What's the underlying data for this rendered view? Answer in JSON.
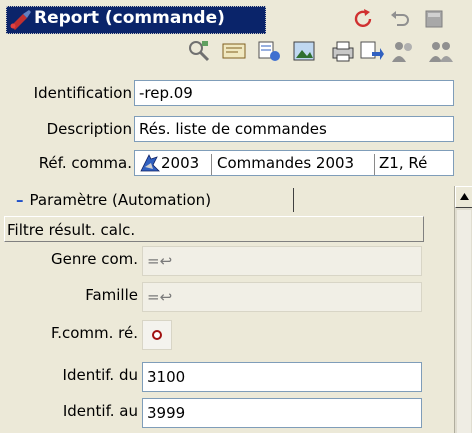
{
  "window": {
    "title": "Report (commande)",
    "title_bar_color": "#0a246a",
    "buttons": [
      "refresh-icon",
      "undo-icon",
      "minimize-icon"
    ]
  },
  "toolbar": {
    "tools": [
      "search-icon",
      "card-icon",
      "filter-icon",
      "image-icon",
      "print-icon",
      "export-icon",
      "people-icon",
      "group-icon"
    ]
  },
  "fields": {
    "identification_label": "Identification",
    "identification_value": "-rep.09",
    "description_label": "Description",
    "description_value": "Rés. liste de commandes",
    "ref_label": "Réf. comma.",
    "ref_part1": "2003",
    "ref_part2": "Commandes 2003",
    "ref_part3": "Z1, Ré"
  },
  "tab": {
    "collapse_symbol": "–",
    "label": "Paramètre (Automation)"
  },
  "group": {
    "header": "Filtre résult. calc."
  },
  "params": {
    "genre_label": "Genre com.",
    "genre_value": "=↩",
    "famille_label": "Famille",
    "famille_value": "=↩",
    "fcomm_label": "F.comm. ré.",
    "identdu_label": "Identif. du",
    "identdu_value": "3100",
    "identau_label": "Identif. au",
    "identau_value": "3999"
  }
}
